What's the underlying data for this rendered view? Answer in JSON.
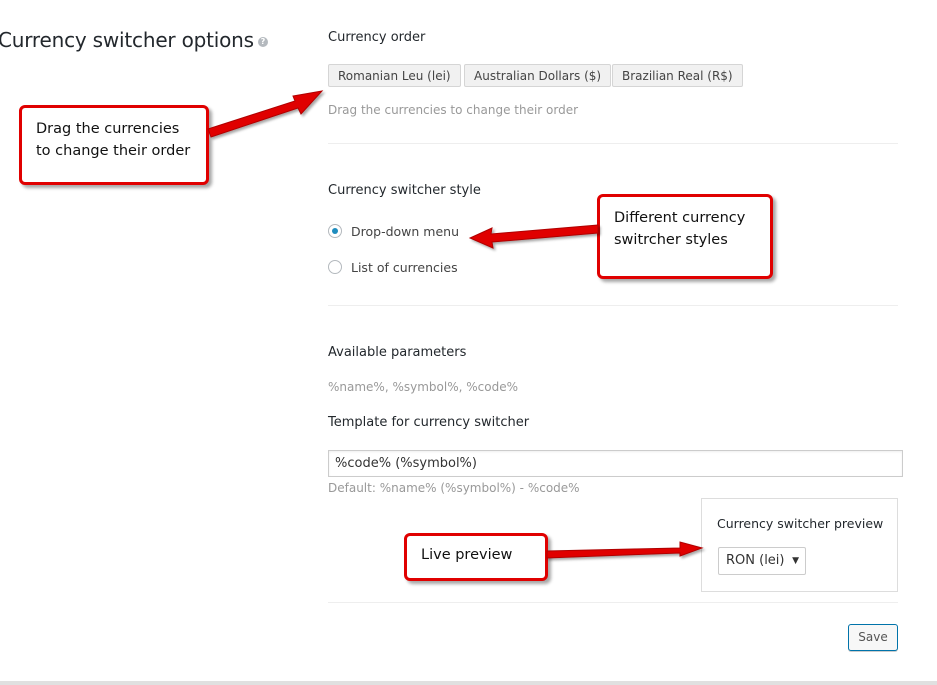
{
  "page": {
    "title": "Currency switcher options"
  },
  "currency_order": {
    "label": "Currency order",
    "items": [
      "Romanian Leu (lei)",
      "Australian Dollars ($)",
      "Brazilian Real (R$)"
    ],
    "description": "Drag the currencies to change their order"
  },
  "switcher_style": {
    "label": "Currency switcher style",
    "options": [
      {
        "label": "Drop-down menu",
        "selected": true
      },
      {
        "label": "List of currencies",
        "selected": false
      }
    ]
  },
  "parameters": {
    "label": "Available parameters",
    "value": "%name%, %symbol%, %code%"
  },
  "template": {
    "label": "Template for currency switcher",
    "value": "%code%  (%symbol%)",
    "default_hint": "Default: %name% (%symbol%) - %code%"
  },
  "preview": {
    "title": "Currency switcher preview",
    "selected": "RON (lei)"
  },
  "actions": {
    "save_label": "Save"
  },
  "annotations": {
    "drag_note": [
      "Drag the currencies",
      "to change their order"
    ],
    "styles_note": [
      "Different currency",
      "switrcher styles"
    ],
    "preview_note": "Live preview"
  },
  "colors": {
    "callout_border": "#e00000",
    "arrow": "#e00000",
    "radio_accent": "#1e8cbe",
    "save_border": "#0073aa"
  }
}
